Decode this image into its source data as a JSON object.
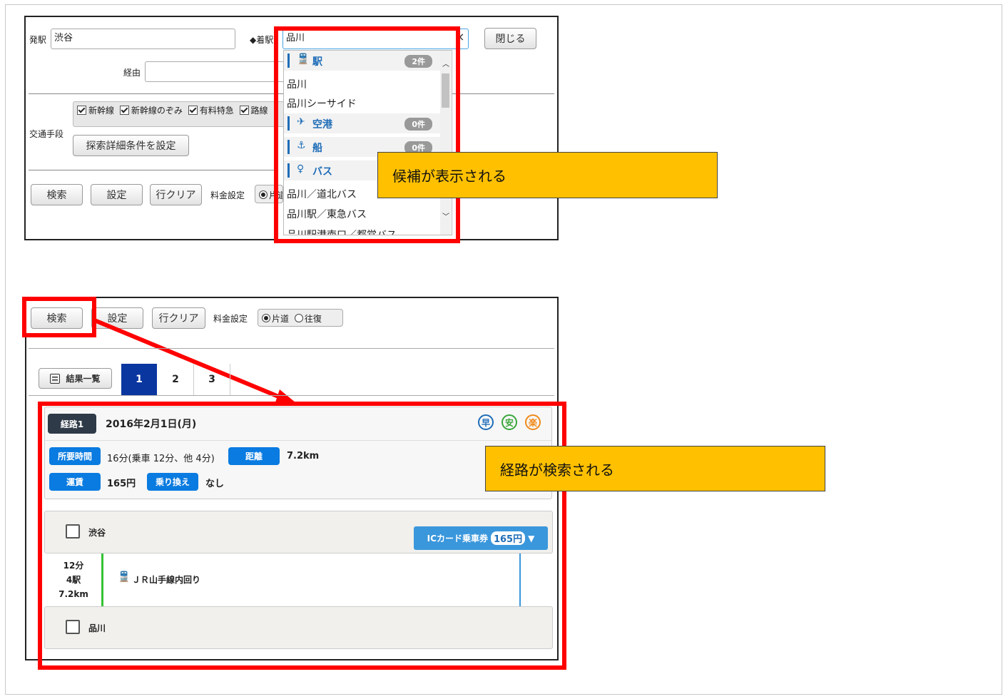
{
  "top_form": {
    "from_label": "発駅",
    "from_value": "渋谷",
    "to_label": "◆着駅",
    "to_value": "品川",
    "close_button": "閉じる",
    "via_label": "経由",
    "transport_label": "交通手段",
    "checkboxes": [
      "新幹線",
      "新幹線のぞみ",
      "有料特急",
      "路線"
    ],
    "detail_button": "探索詳細条件を設定",
    "search_button": "検索",
    "settings_button": "設定",
    "clear_button": "行クリア",
    "fare_label": "料金設定",
    "fare_option_partial": "片道"
  },
  "dropdown": {
    "station_header": "駅",
    "station_count": "2件",
    "stations": [
      "品川",
      "品川シーサイド"
    ],
    "airport_header": "空港",
    "airport_count": "0件",
    "ship_header": "船",
    "ship_count": "0件",
    "bus_header": "バス",
    "bus_stops": [
      "品川／道北バス",
      "品川駅／東急バス",
      "品川駅港南口／都営バス"
    ]
  },
  "callouts": {
    "suggestions": "候補が表示される",
    "route_searched": "経路が検索される"
  },
  "bottom_form": {
    "search_button": "検索",
    "settings_button": "設定",
    "clear_button": "行クリア",
    "fare_label": "料金設定",
    "one_way": "片道",
    "round_trip": "往復"
  },
  "results": {
    "list_button": "結果一覧",
    "tabs": [
      "1",
      "2",
      "3"
    ],
    "route_label": "経路1",
    "date": "2016年2月1日(月)",
    "fast_icon": "早",
    "safe_icon": "安",
    "easy_icon": "楽",
    "time_label": "所要時間",
    "time_value": "16分(乗車 12分、他 4分)",
    "distance_label": "距離",
    "distance_value": "7.2km",
    "fare_label": "運賃",
    "fare_value": "165円",
    "transfer_label": "乗り換え",
    "transfer_value": "なし",
    "departure_station": "渋谷",
    "ic_label": "ICカード乗車券",
    "ic_fare": "165円",
    "segment_minutes": "12分",
    "segment_stations": "4駅",
    "segment_distance": "7.2km",
    "line_name": "ＪＲ山手線内回り",
    "arrival_station": "品川"
  },
  "colors": {
    "highlight_red": "#ff0000",
    "callout_yellow": "#ffc000",
    "tag_blue": "#0a7be0",
    "active_tab": "#0a36a0"
  }
}
